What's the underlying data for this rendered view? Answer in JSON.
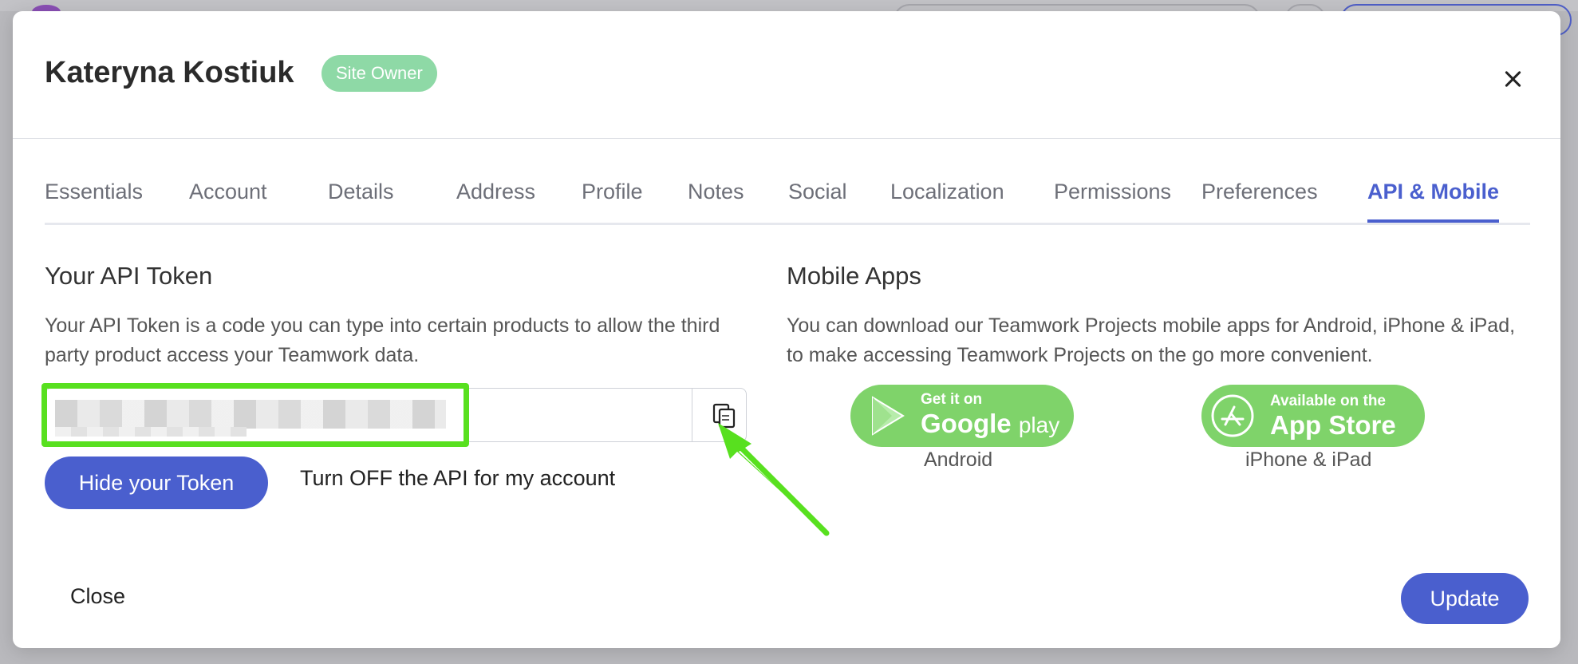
{
  "modal": {
    "title": "Kateryna Kostiuk",
    "badge": "Site Owner",
    "close_icon": "close-icon"
  },
  "tabs": [
    {
      "label": "Essentials"
    },
    {
      "label": "Account"
    },
    {
      "label": "Details"
    },
    {
      "label": "Address"
    },
    {
      "label": "Profile"
    },
    {
      "label": "Notes"
    },
    {
      "label": "Social"
    },
    {
      "label": "Localization"
    },
    {
      "label": "Permissions"
    },
    {
      "label": "Preferences"
    },
    {
      "label": "API & Mobile",
      "active": true
    }
  ],
  "api": {
    "title": "Your API Token",
    "description": "Your API Token is a code you can type into certain products to allow the third party product access your Teamwork data.",
    "token_value": "",
    "copy_icon": "copy-icon",
    "hide_button": "Hide your Token",
    "turn_off_link": "Turn OFF the API for my account"
  },
  "mobile": {
    "title": "Mobile Apps",
    "description": "You can download our Teamwork Projects mobile apps for Android, iPhone & iPad, to make accessing Teamwork Projects on the go more convenient.",
    "google": {
      "small": "Get it on",
      "big_bold": "Google",
      "big_light": "play",
      "caption": "Android",
      "icon": "google-play-icon"
    },
    "apple": {
      "small": "Available on the",
      "big": "App Store",
      "caption": "iPhone & iPad",
      "icon": "app-store-icon"
    }
  },
  "footer": {
    "close_label": "Close",
    "update_label": "Update"
  },
  "colors": {
    "accent": "#4a5fce",
    "badge": "#8ed9a6",
    "store_badge": "#7fd36a",
    "annotation": "#58e01f"
  }
}
